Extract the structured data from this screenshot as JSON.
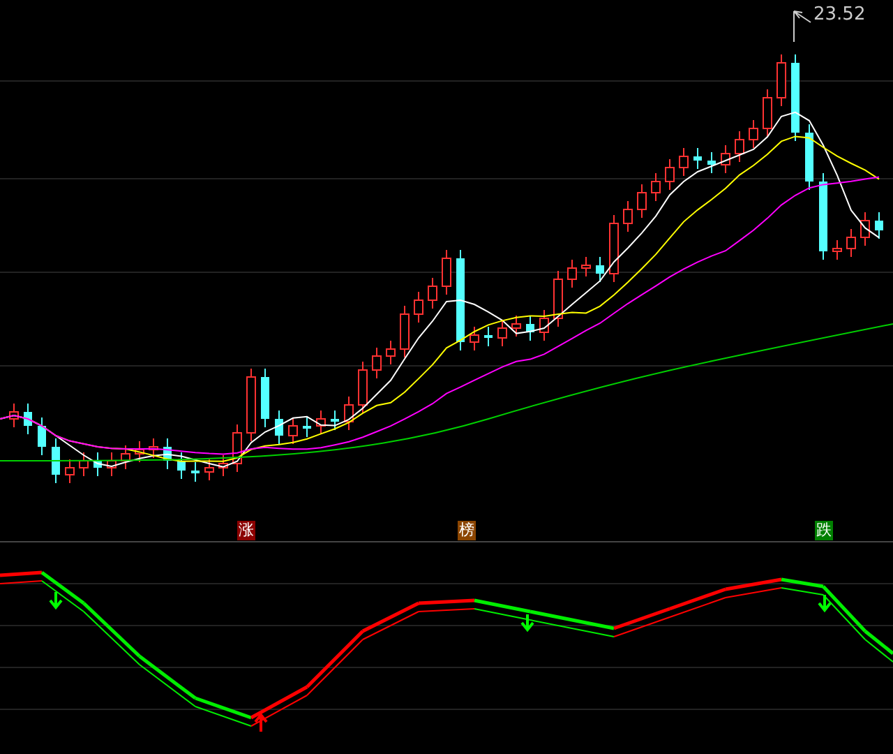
{
  "price_chart": {
    "high_label": "23.52"
  },
  "signals": [
    {
      "label": "涨",
      "color": "#8b0000"
    },
    {
      "label": "榜",
      "color": "#8b4500"
    },
    {
      "label": "跌",
      "color": "#008000"
    }
  ]
}
